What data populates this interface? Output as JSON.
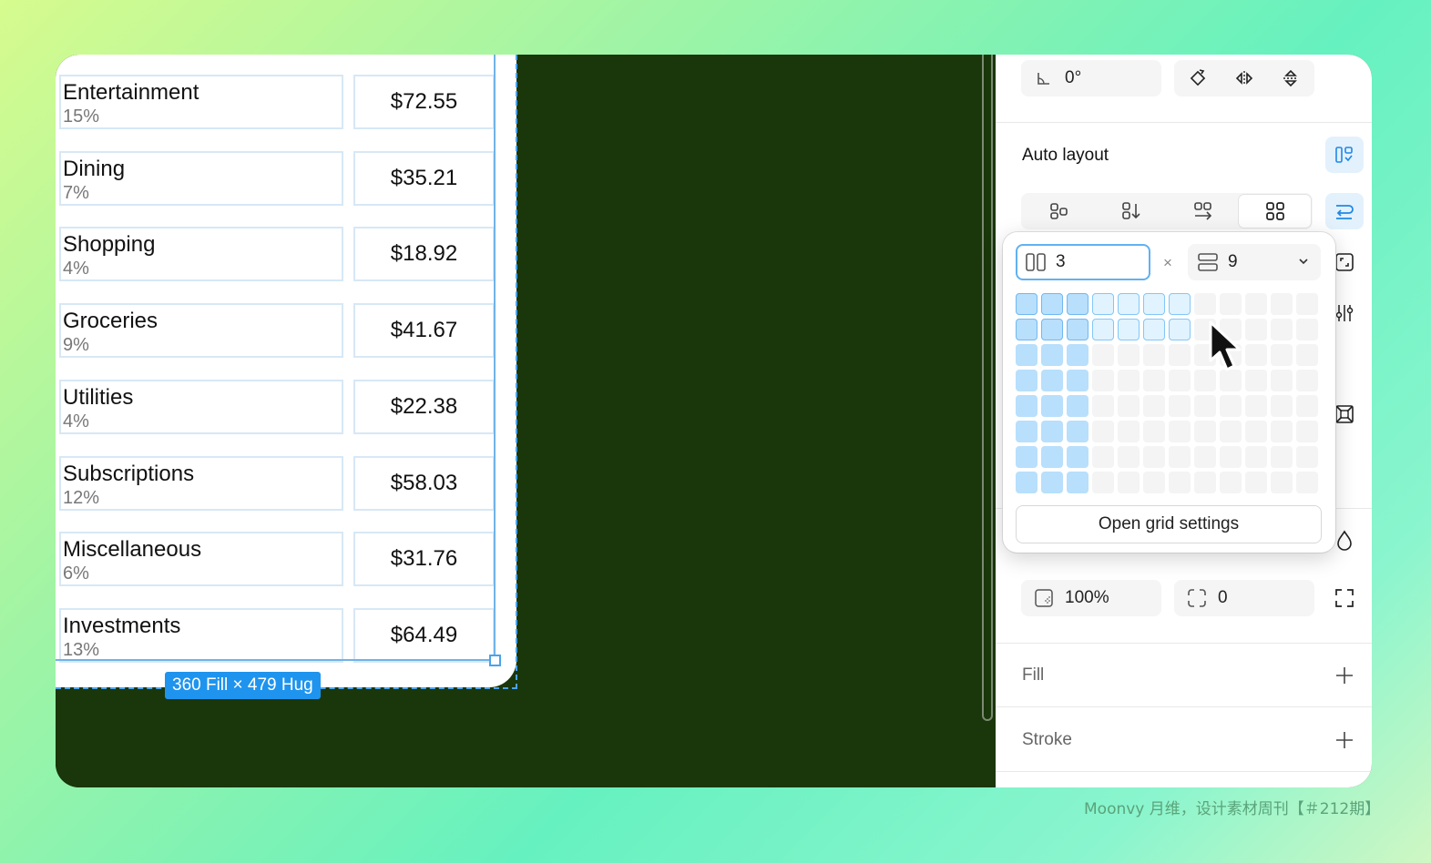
{
  "canvas": {
    "rows": [
      {
        "name": "Entertainment",
        "pct": "15%",
        "amount": "$72.55"
      },
      {
        "name": "Dining",
        "pct": "7%",
        "amount": "$35.21"
      },
      {
        "name": "Shopping",
        "pct": "4%",
        "amount": "$18.92"
      },
      {
        "name": "Groceries",
        "pct": "9%",
        "amount": "$41.67"
      },
      {
        "name": "Utilities",
        "pct": "4%",
        "amount": "$22.38"
      },
      {
        "name": "Subscriptions",
        "pct": "12%",
        "amount": "$58.03"
      },
      {
        "name": "Miscellaneous",
        "pct": "6%",
        "amount": "$31.76"
      },
      {
        "name": "Investments",
        "pct": "13%",
        "amount": "$64.49"
      }
    ],
    "dimension_badge": "360 Fill × 479 Hug"
  },
  "panel": {
    "rotation": "0°",
    "auto_layout_title": "Auto layout",
    "layer_opacity": "100%",
    "corner_radius": "0",
    "fill_title": "Fill",
    "stroke_title": "Stroke"
  },
  "grid_popover": {
    "columns": "3",
    "rows": "9",
    "times": "×",
    "selected_cols": 3,
    "selected_rows": 8,
    "hover_cols": 7,
    "hover_rows": 2,
    "open_settings_label": "Open grid settings"
  },
  "watermark": "Moonvy 月维，设计素材周刊【＃212期】",
  "colors": {
    "canvas_bg": "#1a360b",
    "selection_blue": "#1e94ee",
    "grid_selected": "#b8dffc"
  }
}
